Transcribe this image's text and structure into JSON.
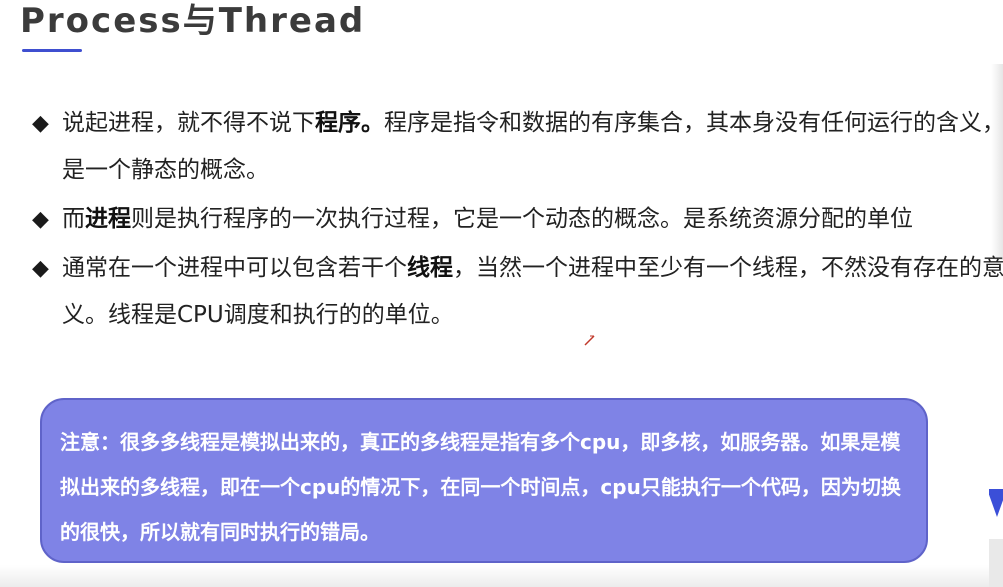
{
  "title": "Process与Thread",
  "bullets": [
    {
      "marker": "◆",
      "before": "说起进程，就不得不说下",
      "bold": "程序。",
      "after": "程序是指令和数据的有序集合，其本身没有任何运行的含义，是一个静态的概念。"
    },
    {
      "marker": "◆",
      "before": "而",
      "bold": "进程",
      "after": "则是执行程序的一次执行过程，它是一个动态的概念。是系统资源分配的单位"
    },
    {
      "marker": "◆",
      "before": "通常在一个进程中可以包含若干个",
      "bold": "线程",
      "after": "，当然一个进程中至少有一个线程，不然没有存在的意义。线程是CPU调度和执行的的单位。"
    }
  ],
  "note": {
    "text": "注意：很多多线程是模拟出来的，真正的多线程是指有多个cpu，即多核，如服务器。如果是模拟出来的多线程，即在一个cpu的情况下，在同一个时间点，cpu只能执行一个代码，因为切换的很快，所以就有同时执行的错局。"
  },
  "colors": {
    "title_underline": "#3f4fd0",
    "note_background": "#7f83e6",
    "note_border": "#5f63c9",
    "note_text": "#ffffff",
    "corner_accent": "#3b4fd8"
  }
}
